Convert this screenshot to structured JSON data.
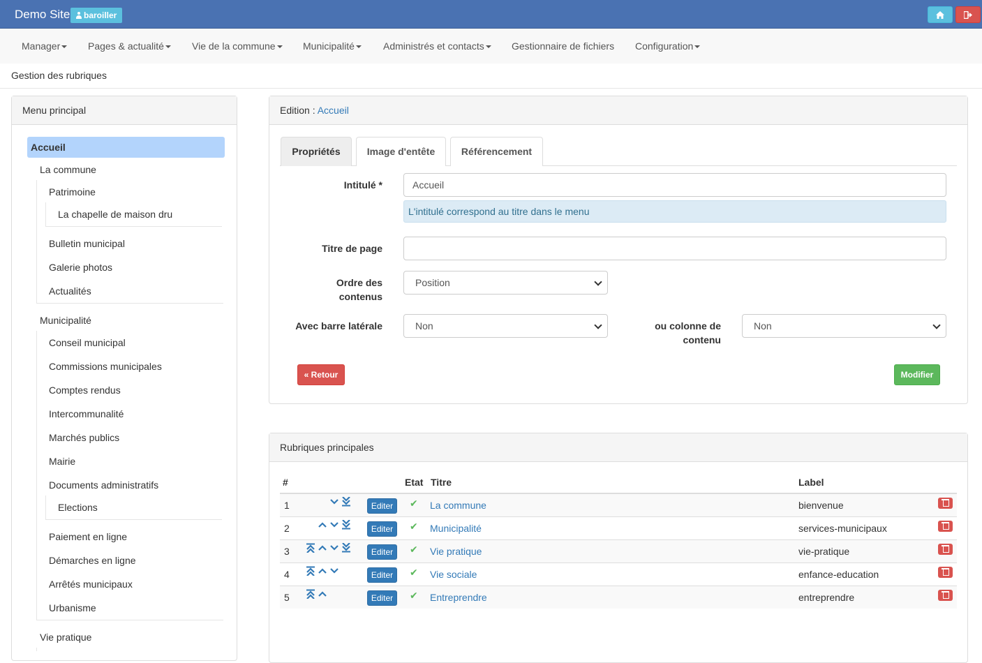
{
  "topbar": {
    "brand": "Demo Site",
    "user": "baroiller",
    "home_icon": "home-icon",
    "logout_icon": "logout-icon"
  },
  "nav": {
    "items": [
      {
        "label": "Manager",
        "dropdown": true
      },
      {
        "label": "Pages & actualité",
        "dropdown": true
      },
      {
        "label": "Vie de la commune",
        "dropdown": true
      },
      {
        "label": "Municipalité",
        "dropdown": true
      },
      {
        "label": "Administrés et contacts",
        "dropdown": true
      },
      {
        "label": "Gestionnaire de fichiers",
        "dropdown": false
      },
      {
        "label": "Configuration",
        "dropdown": true
      }
    ]
  },
  "page_title": "Gestion des rubriques",
  "menu_panel": {
    "title": "Menu principal",
    "tree": [
      {
        "label": "Accueil",
        "active": true
      },
      {
        "label": "La commune"
      },
      {
        "label": "Patrimoine"
      },
      {
        "label": "La chapelle de maison dru"
      },
      {
        "label": "Bulletin municipal"
      },
      {
        "label": "Galerie photos"
      },
      {
        "label": "Actualités"
      },
      {
        "label": "Municipalité"
      },
      {
        "label": "Conseil municipal"
      },
      {
        "label": "Commissions municipales"
      },
      {
        "label": "Comptes rendus"
      },
      {
        "label": "Intercommunalité"
      },
      {
        "label": "Marchés publics"
      },
      {
        "label": "Mairie"
      },
      {
        "label": "Documents administratifs"
      },
      {
        "label": "Elections"
      },
      {
        "label": "Paiement en ligne"
      },
      {
        "label": "Démarches en ligne"
      },
      {
        "label": "Arrêtés municipaux"
      },
      {
        "label": "Urbanisme"
      },
      {
        "label": "Vie pratique"
      }
    ]
  },
  "edit_panel": {
    "prefix": "Edition : ",
    "name": "Accueil",
    "tabs": [
      "Propriétés",
      "Image d'entête",
      "Référencement"
    ],
    "active_tab": "Propriétés",
    "fields": {
      "intitule_label": "Intitulé *",
      "intitule_value": "Accueil",
      "intitule_help": "L'intitulé correspond au titre dans le menu",
      "titre_label": "Titre de page",
      "titre_value": "",
      "ordre_label_1": "Ordre des",
      "ordre_label_2": "contenus",
      "ordre_value": "Position",
      "barre_label": "Avec barre latérale",
      "barre_value": "Non",
      "colonne_label_1": "ou colonne de",
      "colonne_label_2": "contenu",
      "colonne_value": "Non"
    },
    "retour_label": "« Retour",
    "modifier_label": "Modifier"
  },
  "table_panel": {
    "title": "Rubriques principales",
    "headers": {
      "num": "#",
      "etat": "Etat",
      "titre": "Titre",
      "label": "Label"
    },
    "edit_label": "Editer",
    "rows": [
      {
        "num": "1",
        "titre": "La commune",
        "label": "bienvenue",
        "top": false,
        "up": false,
        "down": true,
        "bottom": true
      },
      {
        "num": "2",
        "titre": "Municipalité",
        "label": "services-municipaux",
        "top": false,
        "up": true,
        "down": true,
        "bottom": true
      },
      {
        "num": "3",
        "titre": "Vie pratique",
        "label": "vie-pratique",
        "top": true,
        "up": true,
        "down": true,
        "bottom": true
      },
      {
        "num": "4",
        "titre": "Vie sociale",
        "label": "enfance-education",
        "top": true,
        "up": true,
        "down": true,
        "bottom": false
      },
      {
        "num": "5",
        "titre": "Entreprendre",
        "label": "entreprendre",
        "top": true,
        "up": true,
        "down": false,
        "bottom": false
      }
    ]
  }
}
